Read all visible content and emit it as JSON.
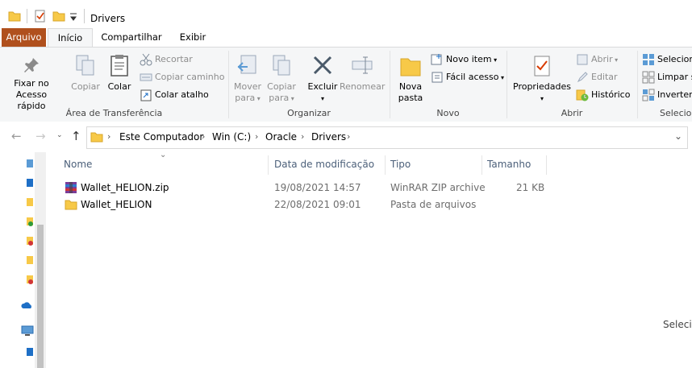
{
  "window": {
    "title": "Drivers"
  },
  "ribbon_tabs": [
    {
      "label": "Arquivo"
    },
    {
      "label": "Início"
    },
    {
      "label": "Compartilhar"
    },
    {
      "label": "Exibir"
    }
  ],
  "ribbon": {
    "clipboard": {
      "label": "Área de Transferência",
      "pin": "Fixar no\nAcesso rápido",
      "pin_l1": "Fixar no",
      "pin_l2": "Acesso rápido",
      "copy": "Copiar",
      "paste": "Colar",
      "cut": "Recortar",
      "copy_path": "Copiar caminho",
      "paste_shortcut": "Colar atalho"
    },
    "organize": {
      "label": "Organizar",
      "move_l1": "Mover",
      "move_l2": "para",
      "copy_l1": "Copiar",
      "copy_l2": "para",
      "delete": "Excluir",
      "rename": "Renomear"
    },
    "new": {
      "label": "Novo",
      "folder_l1": "Nova",
      "folder_l2": "pasta",
      "new_item": "Novo item",
      "easy_access": "Fácil acesso"
    },
    "open": {
      "label": "Abrir",
      "properties": "Propriedades",
      "open": "Abrir",
      "edit": "Editar",
      "history": "Histórico"
    },
    "select": {
      "label": "Selecion",
      "select_all": "Selecion",
      "select_none": "Limpar s",
      "invert": "Inverter"
    }
  },
  "breadcrumb": [
    "Este Computador",
    "Win (C:)",
    "Oracle",
    "Drivers"
  ],
  "columns": [
    "Nome",
    "Data de modificação",
    "Tipo",
    "Tamanho"
  ],
  "files": [
    {
      "name": "Wallet_HELION.zip",
      "modified": "19/08/2021 14:57",
      "type": "WinRAR ZIP archive",
      "size": "21 KB",
      "icon": "winrar-archive-icon"
    },
    {
      "name": "Wallet_HELION",
      "modified": "22/08/2021 09:01",
      "type": "Pasta de arquivos",
      "size": "",
      "icon": "folder-icon"
    }
  ],
  "right_hint": "Selecio",
  "colors": {
    "file_tab": "#b0501d",
    "folder": "#f7c948",
    "accent_blue": "#1e6fc6"
  }
}
